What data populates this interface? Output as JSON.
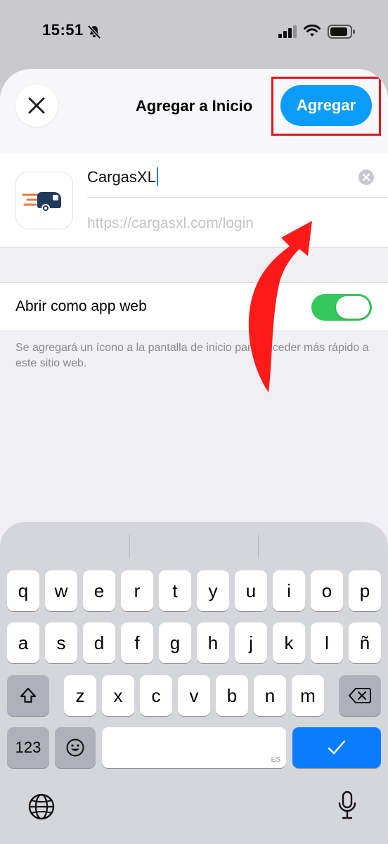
{
  "status_bar": {
    "time": "15:51",
    "icons": [
      "bell-slash-icon",
      "signal-icon",
      "wifi-icon",
      "battery-icon"
    ]
  },
  "sheet": {
    "title": "Agregar a Inicio",
    "close_icon": "close-icon",
    "add_button_label": "Agregar",
    "app_name_value": "CargasXL",
    "url_value": "https://cargasxl.com/login",
    "toggle_label": "Abrir como app web",
    "toggle_on": true,
    "footnote": "Se agregará un ícono a la pantalla de inicio para acceder más rápido a este sitio web."
  },
  "keyboard": {
    "row1": [
      "q",
      "w",
      "e",
      "r",
      "t",
      "y",
      "u",
      "i",
      "o",
      "p"
    ],
    "row2": [
      "a",
      "s",
      "d",
      "f",
      "g",
      "h",
      "j",
      "k",
      "l",
      "ñ"
    ],
    "row3": [
      "z",
      "x",
      "c",
      "v",
      "b",
      "n",
      "m"
    ],
    "numbers_label": "123",
    "space_lang": "ES",
    "done_label": "✓",
    "shift_icon": "shift-icon",
    "delete_icon": "delete-icon",
    "emoji_icon": "emoji-icon",
    "globe_icon": "globe-icon",
    "mic_icon": "mic-icon"
  },
  "colors": {
    "accent": "#0a9cf8",
    "toggle_on": "#34c759",
    "annotation_red": "#e8141c",
    "done_key": "#0a7cff"
  }
}
